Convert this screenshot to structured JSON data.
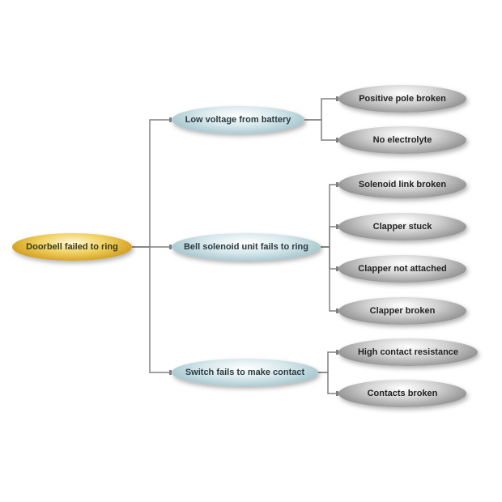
{
  "root": {
    "label": "Doorbell failed to ring"
  },
  "mid": [
    {
      "label": "Low voltage from battery"
    },
    {
      "label": "Bell solenoid unit fails to ring"
    },
    {
      "label": "Switch fails to make contact"
    }
  ],
  "leaf": [
    {
      "label": "Positive pole broken"
    },
    {
      "label": "No electrolyte"
    },
    {
      "label": "Solenoid link broken"
    },
    {
      "label": "Clapper stuck"
    },
    {
      "label": "Clapper not attached"
    },
    {
      "label": "Clapper broken"
    },
    {
      "label": "High contact resistance"
    },
    {
      "label": "Contacts broken"
    }
  ]
}
